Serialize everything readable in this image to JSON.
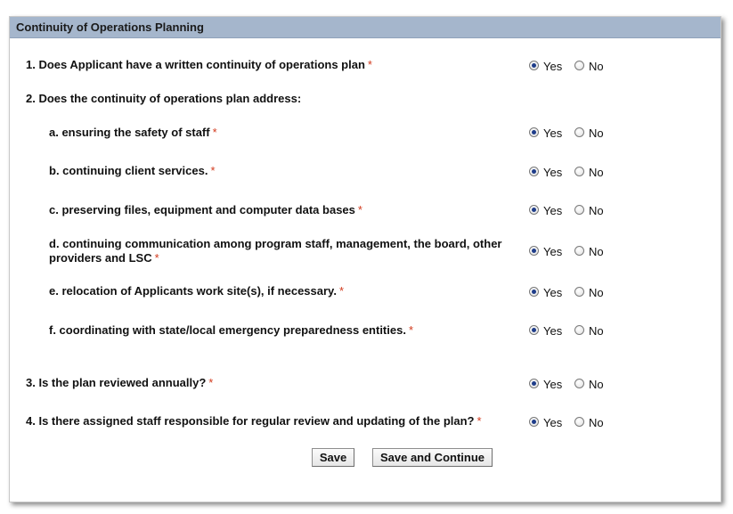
{
  "section_title": "Continuity of Operations Planning",
  "required_marker": "*",
  "questions": [
    {
      "text": "1. Does Applicant have a written continuity of operations plan",
      "required": true,
      "answer": "Yes"
    },
    {
      "text": "2. Does the continuity of operations plan address:",
      "required": false
    },
    {
      "text": "a. ensuring the safety of staff",
      "required": true,
      "answer": "Yes"
    },
    {
      "text": "b. continuing client services.",
      "required": true,
      "answer": "Yes"
    },
    {
      "text": "c. preserving files, equipment and computer data bases",
      "required": true,
      "answer": "Yes"
    },
    {
      "text_line1": "d. continuing communication among program staff, management, the board, other",
      "text_line2": "providers and LSC",
      "required": true,
      "answer": "Yes"
    },
    {
      "text": "e. relocation of Applicants work site(s), if necessary.",
      "required": true,
      "answer": "Yes"
    },
    {
      "text": "f. coordinating with state/local emergency preparedness entities.",
      "required": true,
      "answer": "Yes"
    },
    {
      "text": "3. Is the plan reviewed annually?",
      "required": true,
      "answer": "Yes"
    },
    {
      "text": "4. Is there assigned staff responsible for regular review and updating of the plan?",
      "required": true,
      "answer": "Yes"
    }
  ],
  "options": {
    "yes": "Yes",
    "no": "No"
  },
  "buttons": {
    "save": "Save",
    "save_continue": "Save and Continue"
  }
}
